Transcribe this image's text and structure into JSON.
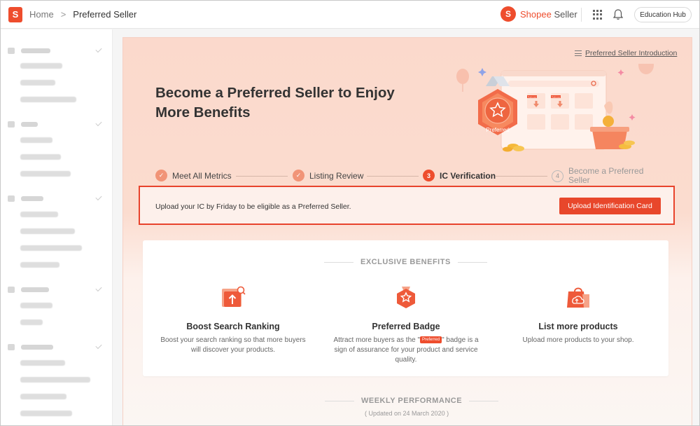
{
  "header": {
    "logo_letter": "S",
    "breadcrumb_home": "Home",
    "breadcrumb_separator": ">",
    "breadcrumb_current": "Preferred Seller",
    "brand_name": "Shopee",
    "brand_suffix": " Seller",
    "education_hub": "Education Hub"
  },
  "hero": {
    "intro_link": "Preferred Seller Introduction",
    "title": "Become a Preferred Seller to Enjoy More Benefits",
    "badge_text": "Preferred",
    "table_labels": [
      "Preferred",
      "Preferred"
    ]
  },
  "steps": [
    {
      "number": "✓",
      "label": "Meet All Metrics",
      "state": "done"
    },
    {
      "number": "✓",
      "label": "Listing Review",
      "state": "done"
    },
    {
      "number": "3",
      "label": "IC Verification",
      "state": "current"
    },
    {
      "number": "4",
      "label": "Become a Preferred Seller",
      "state": "todo"
    }
  ],
  "alert": {
    "message": "Upload your IC by Friday to be eligible as a Preferred Seller.",
    "button": "Upload Identification Card"
  },
  "benefits": {
    "section_title": "EXCLUSIVE BENEFITS",
    "items": [
      {
        "icon": "ranking-icon",
        "title": "Boost Search Ranking",
        "desc": "Boost your search ranking so that more buyers will discover your products."
      },
      {
        "icon": "preferred-badge-icon",
        "title": "Preferred Badge",
        "desc_before": "Attract more buyers as the \"",
        "desc_badge": "Preferred",
        "desc_after": "\" badge is a sign of assurance for your product and service quality."
      },
      {
        "icon": "product-bag-icon",
        "title": "List more products",
        "desc": "Upload more products to your shop."
      }
    ]
  },
  "weekly": {
    "title": "WEEKLY PERFORMANCE",
    "updated": "( Updated on 24 March 2020 )"
  },
  "colors": {
    "brand": "#ee4d2d",
    "step_done": "#f19477",
    "alert_border": "#e8432c"
  }
}
